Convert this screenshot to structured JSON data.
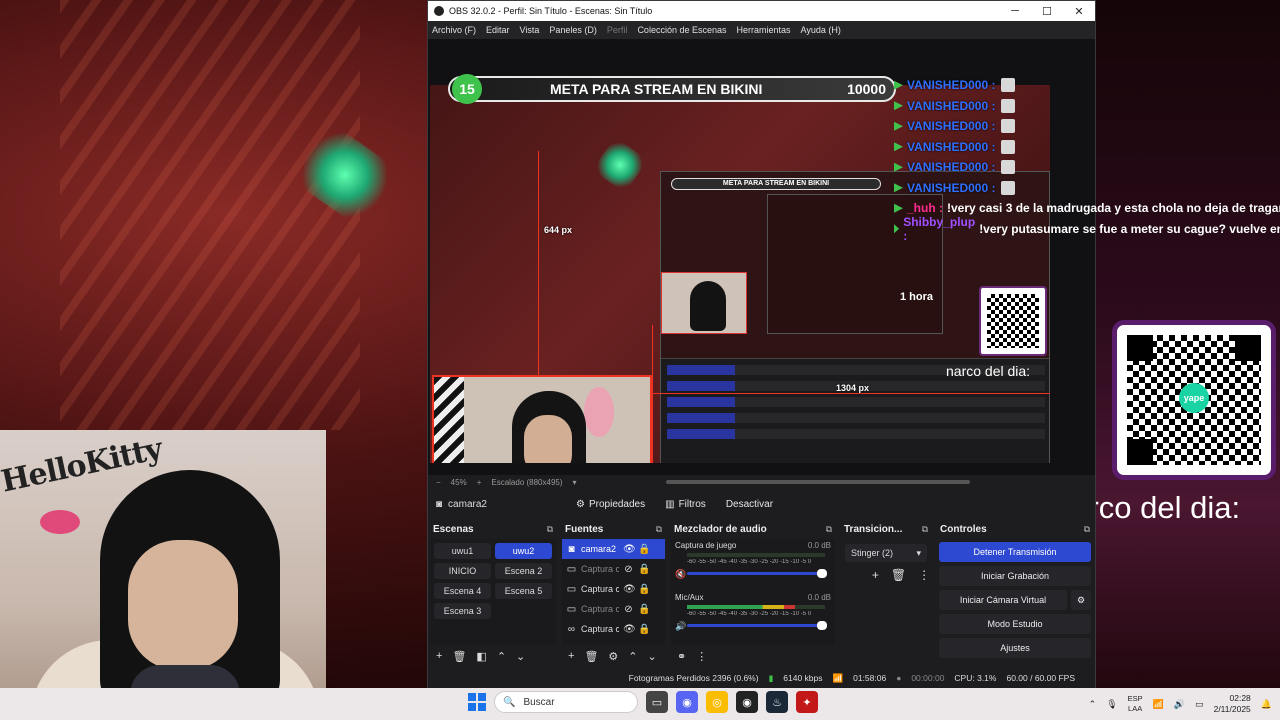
{
  "overlay": {
    "narco_label": "narco del dia:"
  },
  "webcam": {
    "wall_text": "HelloKitty"
  },
  "obs": {
    "title": "OBS 32.0.2 - Perfil: Sin Título - Escenas: Sin Título",
    "window_controls": [
      "─",
      "☐",
      "✕"
    ],
    "menu": [
      "Archivo (F)",
      "Editar",
      "Vista",
      "Paneles (D)",
      "Perfil",
      "Colección de Escenas",
      "Herramientas",
      "Ayuda (H)"
    ],
    "preview": {
      "meta_number": "15",
      "meta_title": "META PARA STREAM EN BIKINI",
      "meta_goal": "10000",
      "mini_meta": "META PARA STREAM EN BIKINI",
      "px_height": "644 px",
      "px_width": "1304 px",
      "hora": "1 hora",
      "narco": "narco del dia:",
      "chat": [
        {
          "user": "VANISHED000 :",
          "msg": ""
        },
        {
          "user": "VANISHED000 :",
          "msg": ""
        },
        {
          "user": "VANISHED000 :",
          "msg": ""
        },
        {
          "user": "VANISHED000 :",
          "msg": ""
        },
        {
          "user": "VANISHED000 :",
          "msg": ""
        },
        {
          "user": "VANISHED000 :",
          "msg": ""
        },
        {
          "user": "_huh :",
          "msg": "!very casi 3 de la madrugada y esta chola no deja de tragar"
        },
        {
          "user": "Shibby_plup :",
          "msg": "!very putasumare se fue a meter su cague? vuelve en"
        }
      ]
    },
    "zoom": {
      "level": "45%",
      "mode": "Escalado (880x495)"
    },
    "source_toolbar": {
      "source_name": "camara2",
      "properties": "Propiedades",
      "filters": "Filtros",
      "deactivate": "Desactivar"
    },
    "scenes": {
      "title": "Escenas",
      "items": [
        "uwu1",
        "uwu2",
        "INICIO",
        "Escena 2",
        "Escena 4",
        "Escena 5",
        "Escena 3"
      ]
    },
    "sources": {
      "title": "Fuentes",
      "items": [
        {
          "name": "camara2",
          "icon": "camera-icon",
          "visible": true,
          "active": true,
          "dim": false
        },
        {
          "name": "Captura c",
          "icon": "window-icon",
          "visible": false,
          "active": false,
          "dim": true
        },
        {
          "name": "Captura c",
          "icon": "window-icon",
          "visible": true,
          "active": false,
          "dim": false
        },
        {
          "name": "Captura c",
          "icon": "window-icon",
          "visible": false,
          "active": false,
          "dim": true
        },
        {
          "name": "Captura c",
          "icon": "link-icon",
          "visible": true,
          "active": false,
          "dim": false
        }
      ]
    },
    "mixer": {
      "title": "Mezclador de audio",
      "channels": [
        {
          "name": "Captura de juego",
          "db": "0.0 dB",
          "level": 0.0,
          "muted": true
        },
        {
          "name": "Mic/Aux",
          "db": "0.0 dB",
          "level": 0.78,
          "muted": false
        }
      ],
      "scale": "-60 -55 -50 -45 -40 -35 -30 -25 -20 -15 -10 -5 0"
    },
    "transitions": {
      "title": "Transicion...",
      "selected": "Stinger (2)"
    },
    "controls": {
      "title": "Controles",
      "stop_stream": "Detener Transmisión",
      "start_recording": "Iniciar Grabación",
      "start_virtual_cam": "Iniciar Cámara Virtual",
      "studio_mode": "Modo Estudio",
      "settings": "Ajustes"
    },
    "status": {
      "dropped": "Fotogramas Perdidos 2396 (0.6%)",
      "bitrate": "6140 kbps",
      "stream_time": "01:58:06",
      "rec_time": "00:00:00",
      "cpu": "CPU: 3.1%",
      "fps": "60.00 / 60.00 FPS"
    }
  },
  "taskbar": {
    "search_placeholder": "Buscar",
    "lang_top": "ESP",
    "lang_bottom": "LAA",
    "time": "02:28",
    "date": "2/11/2025"
  },
  "colors": {
    "accent": "#2e49d1",
    "guide": "#ee3322",
    "meta_green": "#3fc24c"
  }
}
